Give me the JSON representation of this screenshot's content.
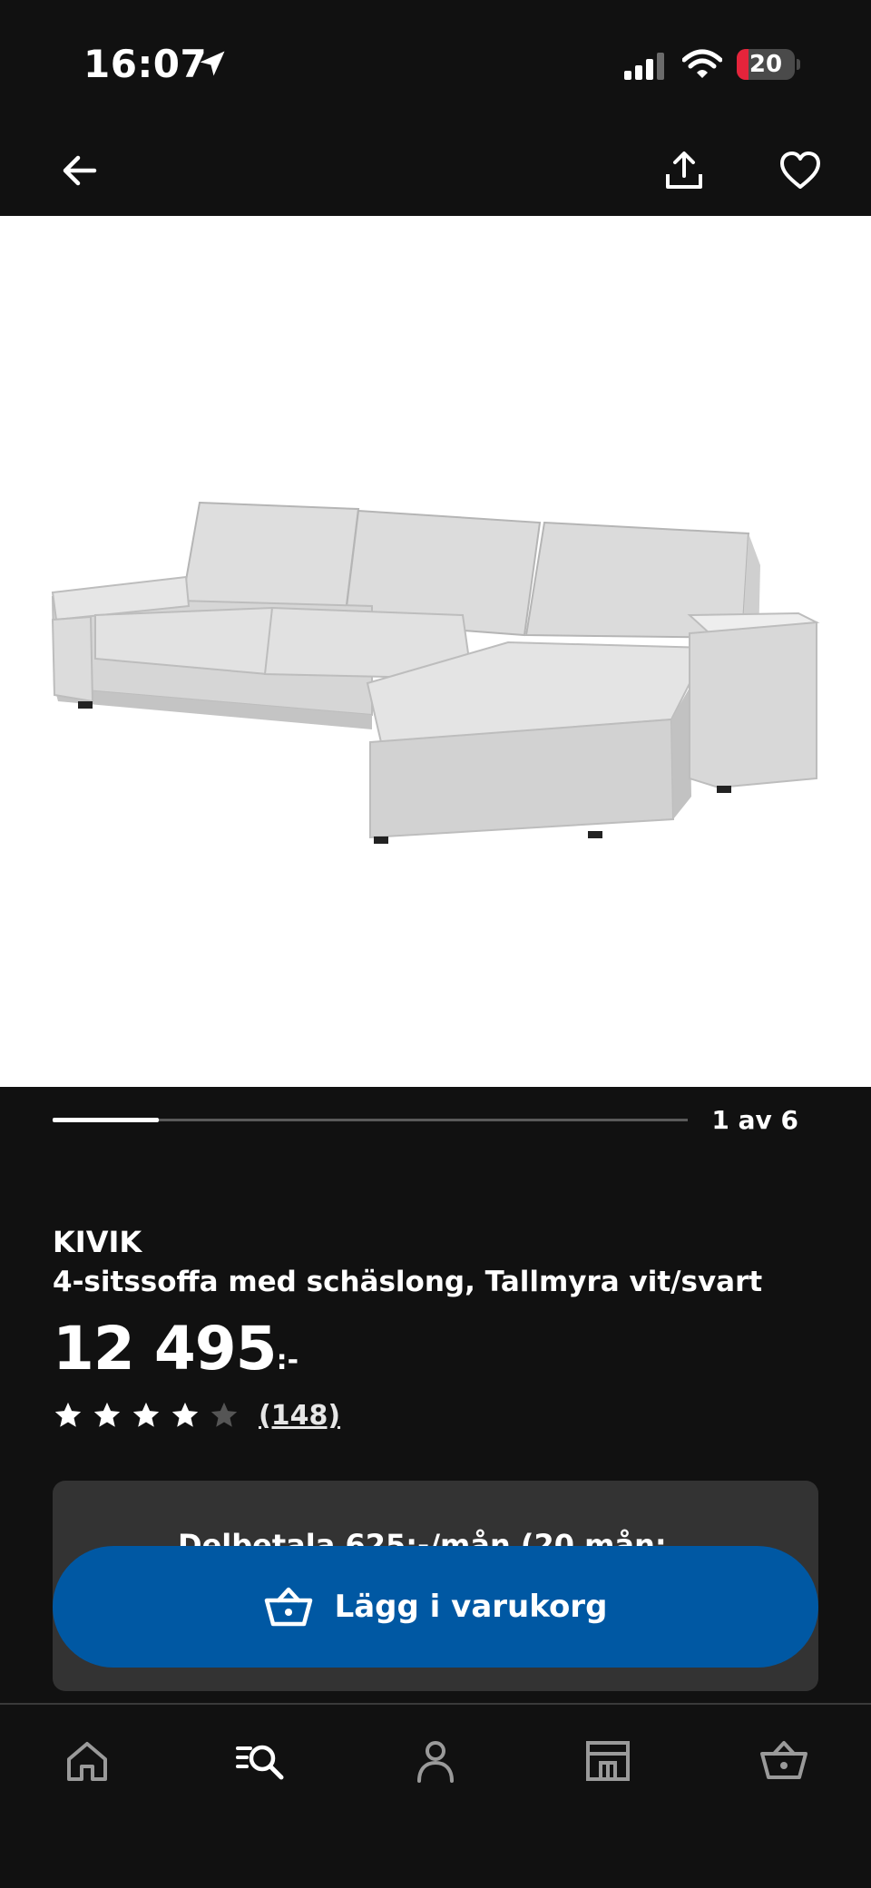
{
  "status_bar": {
    "time": "16:07",
    "battery_level": "20",
    "battery_percent": 20
  },
  "nav": {
    "back_icon": "arrow-left-icon",
    "share_icon": "share-icon",
    "favorite_icon": "heart-icon"
  },
  "gallery": {
    "image": "sofa-product-image",
    "current_index": 1,
    "total": 6,
    "progress_fraction": 0.1667,
    "counter_label": "1 av 6"
  },
  "product": {
    "brand": "KIVIK",
    "description": "4-sitssoffa med schäslong, Tallmyra vit/svart",
    "price": "12 495",
    "price_suffix": ":-",
    "rating": 4,
    "rating_max": 5,
    "review_count": "(148)"
  },
  "installment": {
    "text": "Delbetala 625:-/mån (20 mån;"
  },
  "cta": {
    "label": "Lägg i varukorg",
    "icon": "basket-icon",
    "color": "#0058a3"
  },
  "tabbar": {
    "items": [
      {
        "icon": "home-icon"
      },
      {
        "icon": "search-icon"
      },
      {
        "icon": "profile-icon"
      },
      {
        "icon": "store-icon"
      },
      {
        "icon": "basket-icon"
      }
    ]
  }
}
